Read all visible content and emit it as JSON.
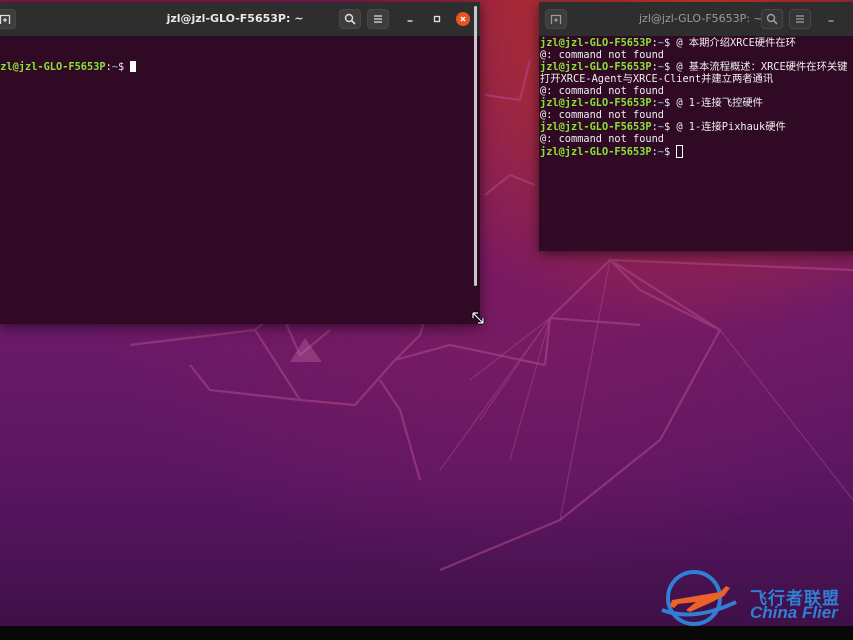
{
  "left_window": {
    "title": "jzl@jzl-GLO-F5653P: ~",
    "prompt_user": "jzl@jzl-GLO-F5653P",
    "prompt_sep": ":",
    "prompt_path": "~",
    "prompt_symbol": "$ "
  },
  "right_window": {
    "title": "jzl@jzl-GLO-F5653P: ~",
    "lines": [
      {
        "user": "jzl@jzl-GLO-F5653P",
        "sep": ":",
        "path": "~",
        "symbol": "$ ",
        "cmd": "@ 本期介绍XRCE硬件在环"
      },
      {
        "output": "@: command not found"
      },
      {
        "user": "jzl@jzl-GLO-F5653P",
        "sep": ":",
        "path": "~",
        "symbol": "$ ",
        "cmd": "@ 基本流程概述：XRCE硬件在环关键"
      },
      {
        "output": "打开XRCE-Agent与XRCE-Client并建立两者通讯"
      },
      {
        "output": "@: command not found"
      },
      {
        "user": "jzl@jzl-GLO-F5653P",
        "sep": ":",
        "path": "~",
        "symbol": "$ ",
        "cmd": "@ 1-连接飞控硬件"
      },
      {
        "output": "@: command not found"
      },
      {
        "user": "jzl@jzl-GLO-F5653P",
        "sep": ":",
        "path": "~",
        "symbol": "$ ",
        "cmd": "@ 1-连接Pixhauk硬件"
      },
      {
        "output": "@: command not found"
      },
      {
        "user": "jzl@jzl-GLO-F5653P",
        "sep": ":",
        "path": "~",
        "symbol": "$ ",
        "cmd": ""
      }
    ]
  },
  "icons": {
    "new_tab": "new-tab-icon",
    "search": "search-icon",
    "menu": "hamburger-menu-icon",
    "minimize": "minimize-icon",
    "maximize": "maximize-icon",
    "close": "close-icon"
  },
  "colors": {
    "terminal_bg": "#300a24",
    "titlebar_bg": "#2e2e2e",
    "prompt_user": "#8ae234",
    "prompt_path": "#729fcf",
    "close_button": "#e95420",
    "watermark": "#2f7fd6"
  },
  "watermark": {
    "cn": "飞行者联盟",
    "en": "China Flier"
  }
}
